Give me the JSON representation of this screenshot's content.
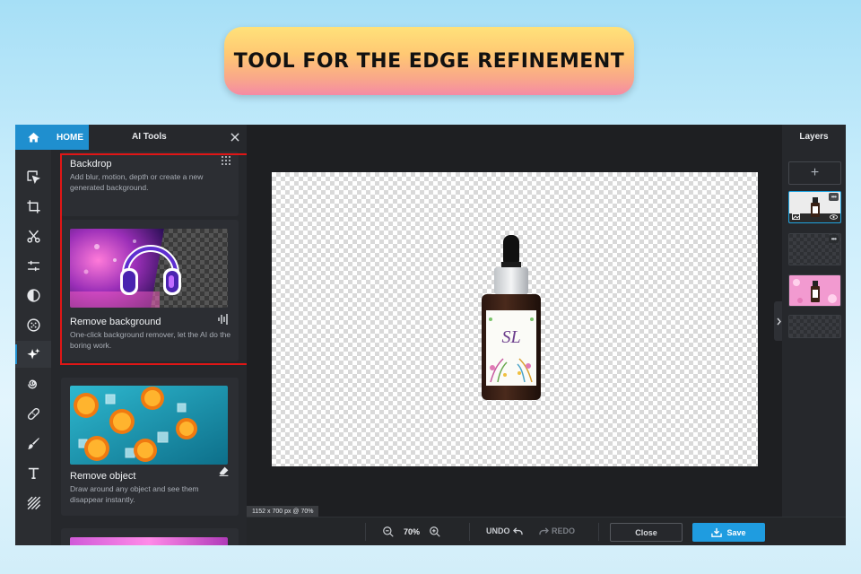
{
  "banner": {
    "title": "TOOL FOR THE EDGE REFINEMENT"
  },
  "header": {
    "home_label": "HOME",
    "panel_title": "AI Tools"
  },
  "tools": {
    "items": [
      {
        "name": "select-tool",
        "icon": "cursor-select-icon"
      },
      {
        "name": "crop-tool",
        "icon": "crop-icon"
      },
      {
        "name": "cut-tool",
        "icon": "scissors-icon"
      },
      {
        "name": "adjust-tool",
        "icon": "sliders-icon"
      },
      {
        "name": "filter-tool",
        "icon": "half-circle-icon"
      },
      {
        "name": "effects-tool",
        "icon": "dots-grid-icon"
      },
      {
        "name": "ai-tool",
        "icon": "sparkle-icon",
        "active": true
      },
      {
        "name": "liquify-tool",
        "icon": "spiral-icon"
      },
      {
        "name": "retouch-tool",
        "icon": "bandage-icon"
      },
      {
        "name": "draw-tool",
        "icon": "brush-icon"
      },
      {
        "name": "text-tool",
        "icon": "text-icon"
      },
      {
        "name": "texture-tool",
        "icon": "diagonal-lines-icon"
      }
    ]
  },
  "cards": {
    "backdrop": {
      "title": "Backdrop",
      "description": "Add blur, motion, depth or create a new generated background.",
      "icon": "dot-grid-icon"
    },
    "remove_background": {
      "title": "Remove background",
      "description": "One-click background remover, let the AI do the boring work.",
      "icon": "waveform-icon"
    },
    "remove_object": {
      "title": "Remove object",
      "description": "Draw around any object and see them disappear instantly.",
      "icon": "eraser-icon"
    }
  },
  "canvas": {
    "info": "1152 x 700 px @ 70%",
    "label_text": "SL"
  },
  "bottom": {
    "zoom": "70%",
    "undo": "UNDO",
    "redo": "REDO",
    "close": "Close",
    "save": "Save"
  },
  "layers": {
    "title": "Layers",
    "add_symbol": "+",
    "more_symbol": "•••"
  },
  "colors": {
    "accent": "#1f9ce0",
    "highlight": "#e01616",
    "app_bg": "#1e1f22",
    "panel_bg": "#26282c"
  }
}
